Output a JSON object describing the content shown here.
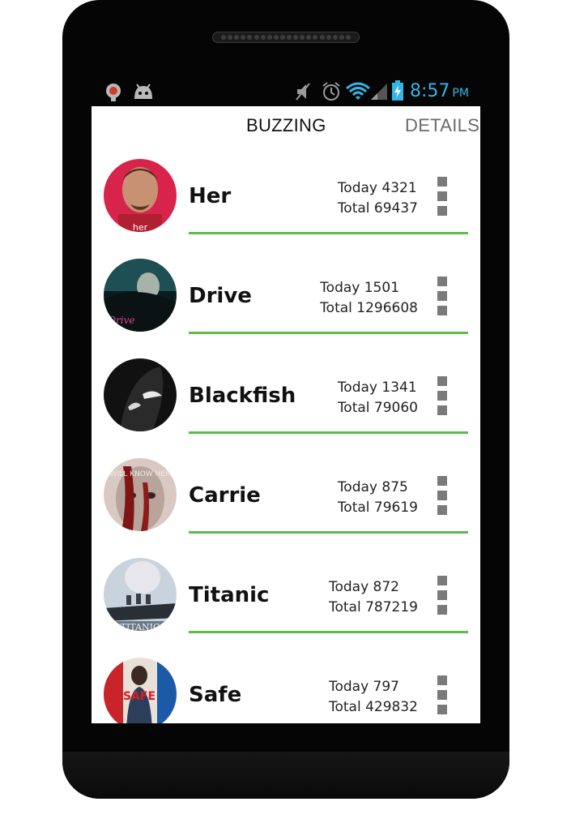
{
  "status_bar": {
    "left_icons": [
      "app-notification-icon",
      "android-icon"
    ],
    "right_icons": [
      "mute-icon",
      "alarm-icon",
      "wifi-icon",
      "signal-icon",
      "battery-charging-icon"
    ],
    "time": "8:57",
    "ampm": "PM",
    "accent_color": "#33b5e5"
  },
  "tabs": [
    {
      "label": "BUZZING",
      "active": true
    },
    {
      "label": "DETAILS",
      "active": false
    }
  ],
  "divider_color": "#5cbe4a",
  "movies": [
    {
      "title": "Her",
      "today": "Today 4321",
      "total": "Total 69437",
      "poster_text": "her"
    },
    {
      "title": "Drive",
      "today": "Today 1501",
      "total": "Total 1296608",
      "poster_text": "Drive"
    },
    {
      "title": "Blackfish",
      "today": "Today 1341",
      "total": "Total 79060",
      "poster_text": ""
    },
    {
      "title": "Carrie",
      "today": "Today 875",
      "total": "Total 79619",
      "poster_text": "WILL KNOW HER"
    },
    {
      "title": "Titanic",
      "today": "Today 872",
      "total": "Total 787219",
      "poster_text": "TITANIC"
    },
    {
      "title": "Safe",
      "today": "Today 797",
      "total": "Total 429832",
      "poster_text": "SAFE"
    }
  ]
}
